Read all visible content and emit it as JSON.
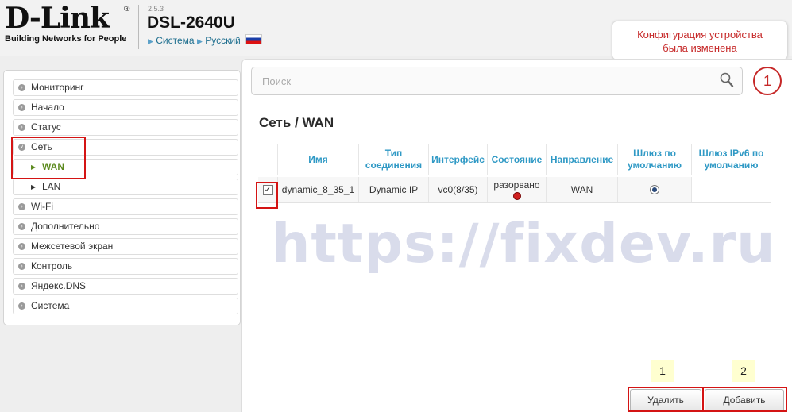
{
  "header": {
    "brand": "D-Link",
    "registered": "®",
    "tagline": "Building Networks for People",
    "version": "2.5.3",
    "model": "DSL-2640U",
    "links": {
      "system": "Система",
      "language": "Русский"
    }
  },
  "tooltip": {
    "line1": "Конфигурация устройства",
    "line2": "была изменена"
  },
  "notification_count": "1",
  "search": {
    "placeholder": "Поиск"
  },
  "sidebar": {
    "items": [
      {
        "label": "Мониторинг"
      },
      {
        "label": "Начало"
      },
      {
        "label": "Статус"
      },
      {
        "label": "Сеть",
        "expanded": true
      },
      {
        "label": "WAN",
        "sub": true,
        "active": true
      },
      {
        "label": "LAN",
        "sub": true
      },
      {
        "label": "Wi-Fi"
      },
      {
        "label": "Дополнительно"
      },
      {
        "label": "Межсетевой экран"
      },
      {
        "label": "Контроль"
      },
      {
        "label": "Яндекс.DNS"
      },
      {
        "label": "Система"
      }
    ]
  },
  "page_title": "Сеть /  WAN",
  "table": {
    "headers": {
      "name": "Имя",
      "conn_type": "Тип соединения",
      "interface": "Интерфейс",
      "state": "Состояние",
      "direction": "Направление",
      "gateway": "Шлюз по умолчанию",
      "gateway_ipv6": "Шлюз IPv6 по умолчанию"
    },
    "rows": [
      {
        "checked": true,
        "name": "dynamic_8_35_1",
        "conn_type": "Dynamic IP",
        "interface": "vc0(8/35)",
        "state": "разорвано",
        "state_color": "#d02020",
        "direction": "WAN",
        "gateway_selected": true,
        "gateway_ipv6": ""
      }
    ]
  },
  "watermark": "https://fixdev.ru",
  "steps": {
    "one": "1",
    "two": "2"
  },
  "buttons": {
    "delete": "Удалить",
    "add": "Добавить"
  },
  "colors": {
    "accent": "#2f99c5",
    "highlight": "#d41414",
    "active_nav": "#5c8a1e"
  }
}
